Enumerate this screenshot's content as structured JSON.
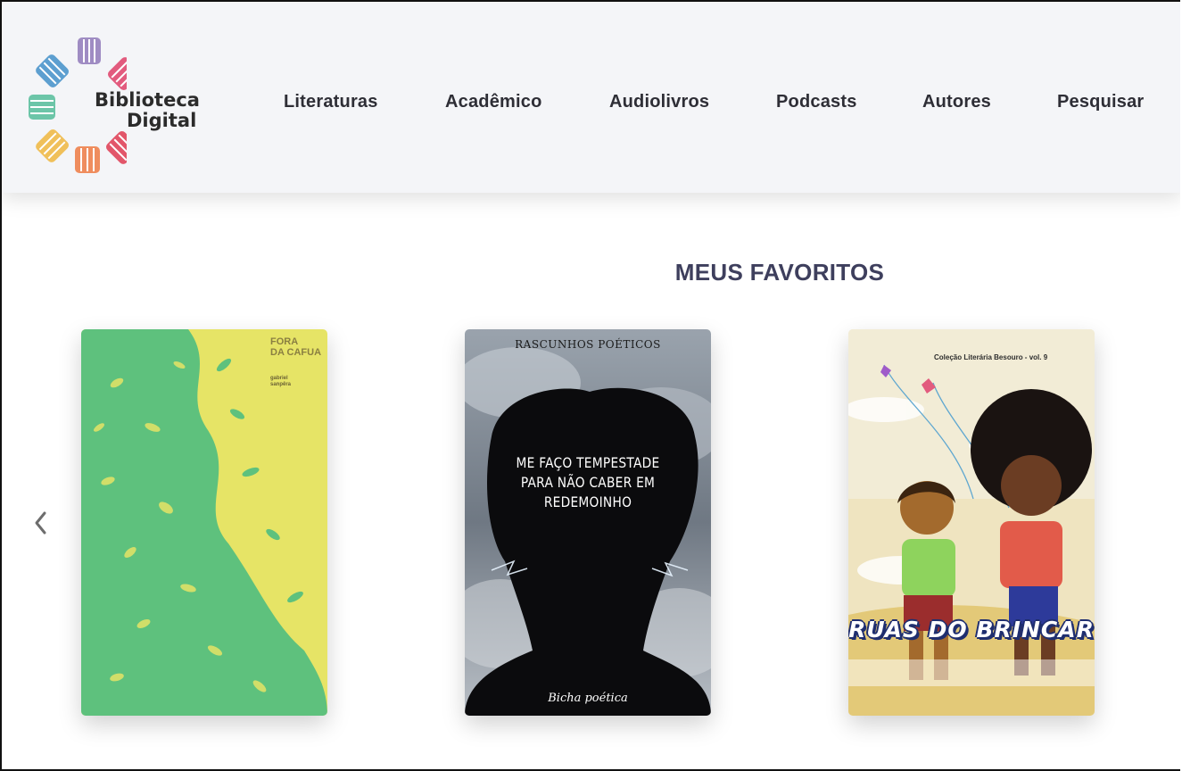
{
  "brand": {
    "name_line1": "Biblioteca",
    "name_line2": "Digital",
    "logo_icon": "book-circle-logo",
    "colors": [
      "#5d9fd0",
      "#9f8cc3",
      "#e25b7e",
      "#6cc5a8",
      "#f0c05a",
      "#ef8d5e"
    ]
  },
  "nav": {
    "items": [
      {
        "label": "Literaturas"
      },
      {
        "label": "Acadêmico"
      },
      {
        "label": "Audiolivros"
      },
      {
        "label": "Podcasts"
      },
      {
        "label": "Autores"
      },
      {
        "label": "Pesquisar"
      }
    ]
  },
  "favorites": {
    "title": "MEUS FAVORITOS",
    "prev_icon": "chevron-left-icon",
    "books": [
      {
        "cover_title_line1": "FORA",
        "cover_title_line2": "DA CAFUA",
        "cover_author_line1": "gabriel",
        "cover_author_line2": "sanpêra",
        "cover_colors": {
          "background": "#e6e466",
          "foliage": "#5ec17d"
        }
      },
      {
        "cover_series": "RASCUNHOS POÉTICOS",
        "cover_title_line1": "ME FAÇO TEMPESTADE",
        "cover_title_line2": "PARA NÃO CABER EM REDEMOINHO",
        "cover_author": "Bicha poética",
        "cover_colors": {
          "background": "#7d8793",
          "silhouette": "#0b0b0d"
        }
      },
      {
        "cover_series": "Coleção Literária Besouro - vol. 9",
        "cover_title": "RUAS DO BRINCAR",
        "cover_colors": {
          "background": "#efe4c0",
          "title_outline": "#1f2e6f"
        }
      }
    ]
  }
}
